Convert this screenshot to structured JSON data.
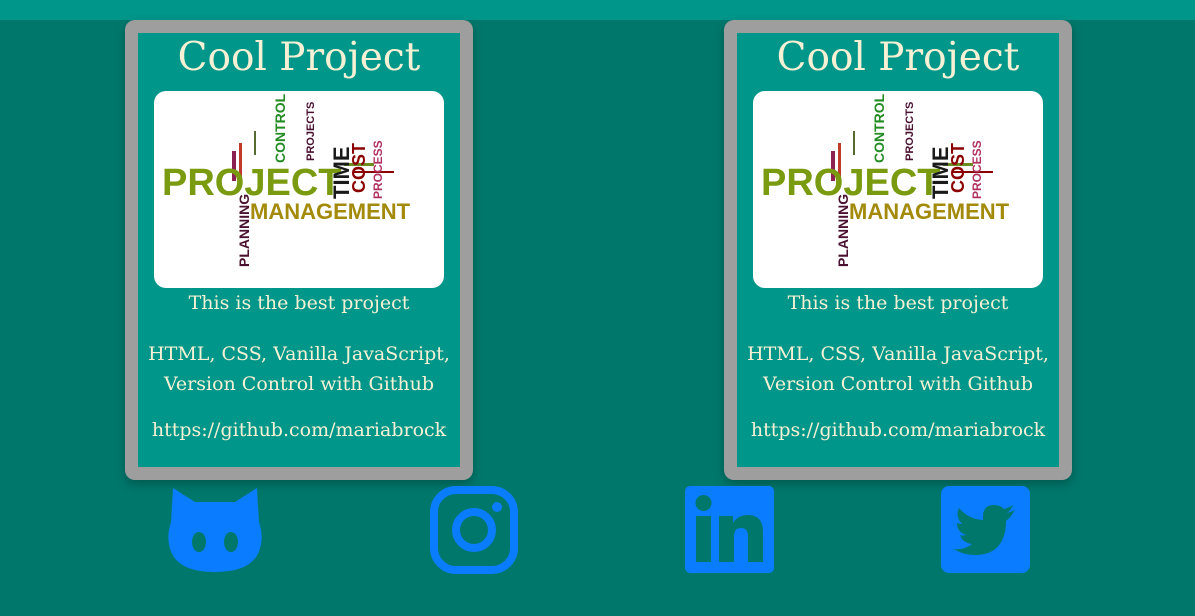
{
  "header": {
    "accent": "#00968a"
  },
  "background": "#00776b",
  "projects": [
    {
      "title": "Cool Project",
      "image_text": {
        "word1": "PROJECT",
        "word2": "MANAGEMENT",
        "word3": "TIME",
        "word4": "COST",
        "word5": "CONTROL",
        "word6": "PLANNING",
        "word7": "PROCESS",
        "word8": "PROJECTS"
      },
      "description": "This is the best project",
      "tech": "HTML, CSS, Vanilla JavaScript, Version Control with Github",
      "link": "https://github.com/mariabrock"
    },
    {
      "title": "Cool Project",
      "image_text": {
        "word1": "PROJECT",
        "word2": "MANAGEMENT",
        "word3": "TIME",
        "word4": "COST",
        "word5": "CONTROL",
        "word6": "PLANNING",
        "word7": "PROCESS",
        "word8": "PROJECTS"
      },
      "description": "This is the best project",
      "tech": "HTML, CSS, Vanilla JavaScript, Version Control with Github",
      "link": "https://github.com/mariabrock"
    }
  ],
  "social": [
    {
      "name": "github-icon",
      "color": "#0a7cff"
    },
    {
      "name": "instagram-icon",
      "color": "#0a7cff"
    },
    {
      "name": "linkedin-icon",
      "color": "#0a7cff"
    },
    {
      "name": "twitter-icon",
      "color": "#0a7cff"
    }
  ]
}
